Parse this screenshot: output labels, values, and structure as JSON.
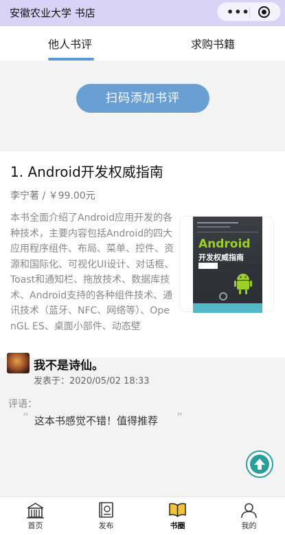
{
  "app_title": "安徽农业大学 书店",
  "capsule": {
    "more_icon": "more-dots-icon",
    "close_icon": "target-circle-icon"
  },
  "tabs": [
    {
      "label": "他人书评",
      "active": true
    },
    {
      "label": "求购书籍",
      "active": false
    }
  ],
  "scan_button": {
    "label": "扫码添加书评"
  },
  "book": {
    "title": "1. Android开发权威指南",
    "meta": "李宁著 / ￥99.00元",
    "description": "本书全面介绍了Android应用开发的各种技术，主要内容包括Android的四大应用程序组件、布局、菜单、控件、资源和国际化、可视化UI设计、对话框、Toast和通知栏、拖放技术、数据库技术、Android支持的各种组件技术、通讯技术（蓝牙、NFC、网络等）、OpenGL ES、桌面小部件、动态壁",
    "cover": {
      "logo": "Android",
      "title": "开发权威指南"
    }
  },
  "review": {
    "reviewer": "我不是诗仙。",
    "posted_at": "发表于：2020/05/02 18:33",
    "comment_label": "评语：",
    "quote_open": "“",
    "comment": "这本书感觉不错！值得推荐",
    "quote_close": "”"
  },
  "back_to_top": {
    "icon": "arrow-up-icon",
    "color": "#2a9f9a"
  },
  "tabbar": [
    {
      "label": "首页",
      "icon": "home-building-icon",
      "active": false
    },
    {
      "label": "发布",
      "icon": "publish-book-icon",
      "active": false
    },
    {
      "label": "书圈",
      "icon": "open-book-icon",
      "active": true
    },
    {
      "label": "我的",
      "icon": "user-profile-icon",
      "active": false
    }
  ],
  "colors": {
    "navbar": "#d9d4f7",
    "accent": "#5b97d4",
    "scan_button": "#6a9fd4"
  }
}
